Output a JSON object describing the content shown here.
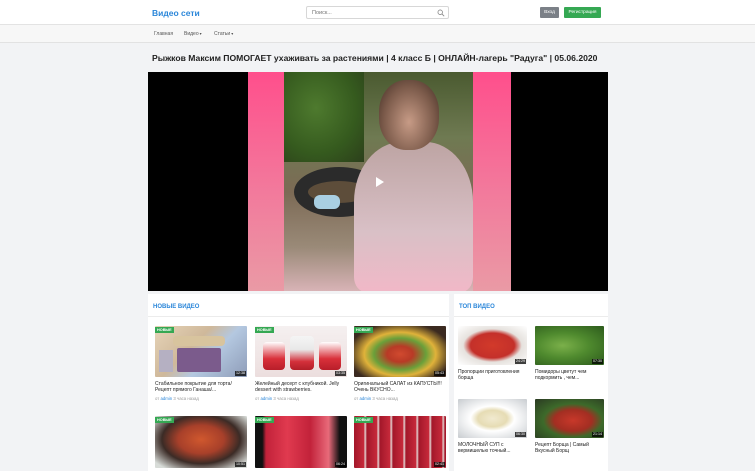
{
  "header": {
    "logo": "Видео сети",
    "search_placeholder": "Поиск...",
    "login": "Вход",
    "register": "Регистрация"
  },
  "nav": {
    "items": [
      {
        "label": "Главная"
      },
      {
        "label": "Видео"
      },
      {
        "label": "Статьи"
      }
    ]
  },
  "video": {
    "title": "Рыжков Максим ПОМОГАЕТ ухаживать за растениями | 4 класс Б | ОНЛАЙН-лагерь \"Радуга\" | 05.06.2020"
  },
  "new_videos": {
    "heading": "НОВЫЕ ВИДЕО",
    "badge": "НОВЫЕ",
    "items": [
      {
        "title": "Стабильное покрытие для торта/ Рецепт прямого Ганаша/...",
        "author_prefix": "от",
        "author": "admin",
        "time": "3 часа назад",
        "duration": "12:38"
      },
      {
        "title": "Желейный десерт с клубникой. Jelly dessert with strawberries.",
        "author_prefix": "от",
        "author": "admin",
        "time": "3 часа назад",
        "duration": "03:35"
      },
      {
        "title": "Оригинальный САЛАТ из КАПУСТЫ!!! Очень ВКУСНО...",
        "author_prefix": "от",
        "author": "admin",
        "time": "3 часа назад",
        "duration": "05:43"
      },
      {
        "duration": "10:51"
      },
      {
        "duration": "06:24"
      },
      {
        "duration": "02:41"
      }
    ]
  },
  "top_videos": {
    "heading": "ТОП ВИДЕО",
    "items": [
      {
        "title": "Пропорции приготовления борща",
        "duration": "24:29"
      },
      {
        "title": "Помидоры цветут чем подкормить , чем...",
        "duration": "07:30"
      },
      {
        "title": "МОЛОЧНЫЙ СУП с вермишелью точный...",
        "duration": "06:30"
      },
      {
        "title": "Рецепт Борща | Самый Вкусный Борщ",
        "duration": "21:14"
      }
    ]
  },
  "colors": {
    "accent": "#2a86d9",
    "new_badge": "#35a853",
    "login_btn": "#7b8087",
    "register_btn": "#35a853"
  }
}
